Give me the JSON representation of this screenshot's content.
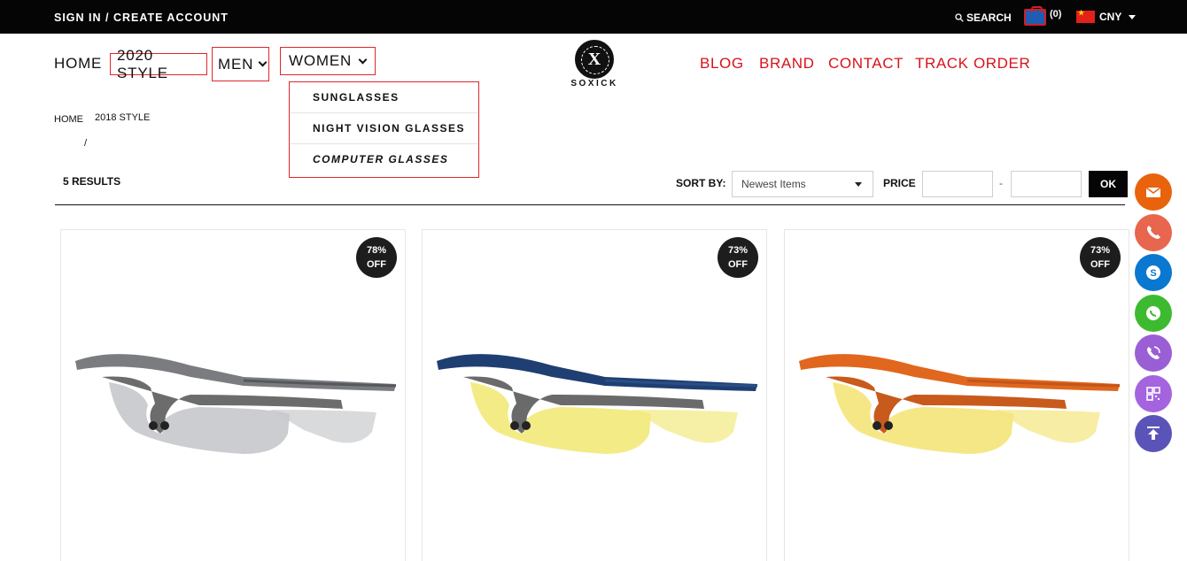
{
  "topbar": {
    "signin": "SIGN IN / CREATE ACCOUNT",
    "search": "SEARCH",
    "cart_count": "(0)",
    "currency": "CNY"
  },
  "nav": {
    "home": "HOME",
    "style2020": "2020 STYLE",
    "men": "MEN",
    "women": "WOMEN",
    "blog": "BLOG",
    "brand": "BRAND",
    "contact": "CONTACT",
    "track": "TRACK ORDER"
  },
  "logo": {
    "text": "SOXICK",
    "mark": "X"
  },
  "dropdown": [
    "SUNGLASSES",
    "NIGHT VISION GLASSES",
    "COMPUTER GLASSES"
  ],
  "breadcrumb": {
    "home": "HOME",
    "current": "2018 STYLE",
    "separator": "/"
  },
  "toolbar": {
    "results": "5 RESULTS",
    "sort_label": "SORT BY:",
    "sort_value": "Newest Items",
    "price_label": "PRICE",
    "price_sep": "-",
    "ok": "OK"
  },
  "products": [
    {
      "discount": "78%",
      "off": "OFF",
      "frame": "#6c6c6c",
      "temple": "#7a7c80",
      "lens": "#c8cacd",
      "accent": "#55585d"
    },
    {
      "discount": "73%",
      "off": "OFF",
      "frame": "#6a6a6a",
      "temple": "#1f3f72",
      "lens": "#f2ea80",
      "accent": "#2b4e86"
    },
    {
      "discount": "73%",
      "off": "OFF",
      "frame": "#c85a1c",
      "temple": "#e0671d",
      "lens": "#f4e67e",
      "accent": "#c2561a"
    }
  ],
  "side_buttons": [
    {
      "icon": "email-icon",
      "color": "#e8630c"
    },
    {
      "icon": "phone-icon",
      "color": "#e8654e"
    },
    {
      "icon": "skype-icon",
      "color": "#0a78d0"
    },
    {
      "icon": "whatsapp-icon",
      "color": "#3dba2f"
    },
    {
      "icon": "viber-icon",
      "color": "#9a5fd4"
    },
    {
      "icon": "qrcode-icon",
      "color": "#a464e0"
    },
    {
      "icon": "back-to-top-icon",
      "color": "#5a54b8"
    }
  ]
}
